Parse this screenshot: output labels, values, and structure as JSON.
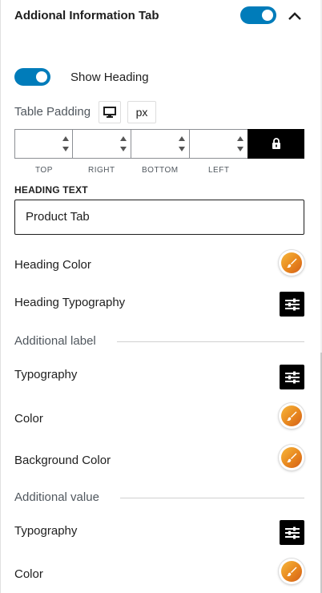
{
  "panel": {
    "title": "Addional Information Tab",
    "enabled": true
  },
  "show_heading": {
    "label": "Show Heading",
    "enabled": true
  },
  "table_padding": {
    "label": "Table Padding",
    "device_icon": "desktop-icon",
    "unit": "px",
    "fields": [
      {
        "label": "TOP",
        "value": ""
      },
      {
        "label": "RIGHT",
        "value": ""
      },
      {
        "label": "BOTTOM",
        "value": ""
      },
      {
        "label": "LEFT",
        "value": ""
      }
    ],
    "link_icon": "lock-icon"
  },
  "heading_text": {
    "caption": "HEADING TEXT",
    "value": "Product Tab"
  },
  "heading_color": {
    "label": "Heading Color"
  },
  "heading_typography": {
    "label": "Heading Typography"
  },
  "additional_label": {
    "title": "Additional label",
    "typography": {
      "label": "Typography"
    },
    "color": {
      "label": "Color"
    },
    "background_color": {
      "label": "Background Color"
    }
  },
  "additional_value": {
    "title": "Additional value",
    "typography": {
      "label": "Typography"
    },
    "color": {
      "label": "Color"
    }
  },
  "colors": {
    "accent": "#007cba",
    "dark_button": "#000000",
    "swatch_gradient": [
      "#f6b73c",
      "#e8871e",
      "#d35f1a"
    ]
  }
}
